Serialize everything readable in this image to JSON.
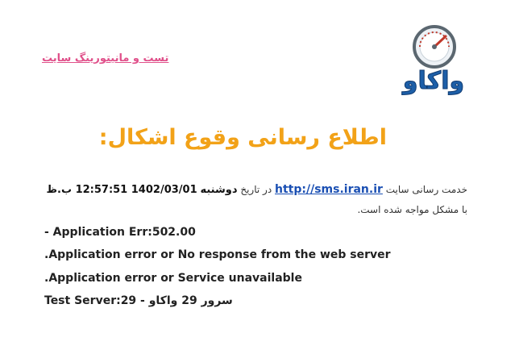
{
  "header": {
    "link_text": "تست و مانیتورینگ سایت",
    "logo_text": "واکاو"
  },
  "title": "اطلاع رسانی وقوع اشکال:",
  "intro": {
    "prefix": "خدمت رسانی سایت",
    "site_link": "http://sms.iran.ir",
    "date_word": "در تاریخ",
    "weekday": "دوشنبه",
    "datetime": "1402/03/01 12:57:51 ب.ظ",
    "suffix": "با مشکل مواجه شده است."
  },
  "errors": [
    "- Application Err:502.00",
    ".Application error or No response from the web server",
    ".Application error or Service unavailable",
    "Test Server:29 - سرور 29 واکاو"
  ],
  "colors": {
    "title": "#f2a218",
    "link_pink": "#e0508a",
    "link_blue": "#1a4fb3",
    "logo_blue": "#1d5fa8"
  }
}
